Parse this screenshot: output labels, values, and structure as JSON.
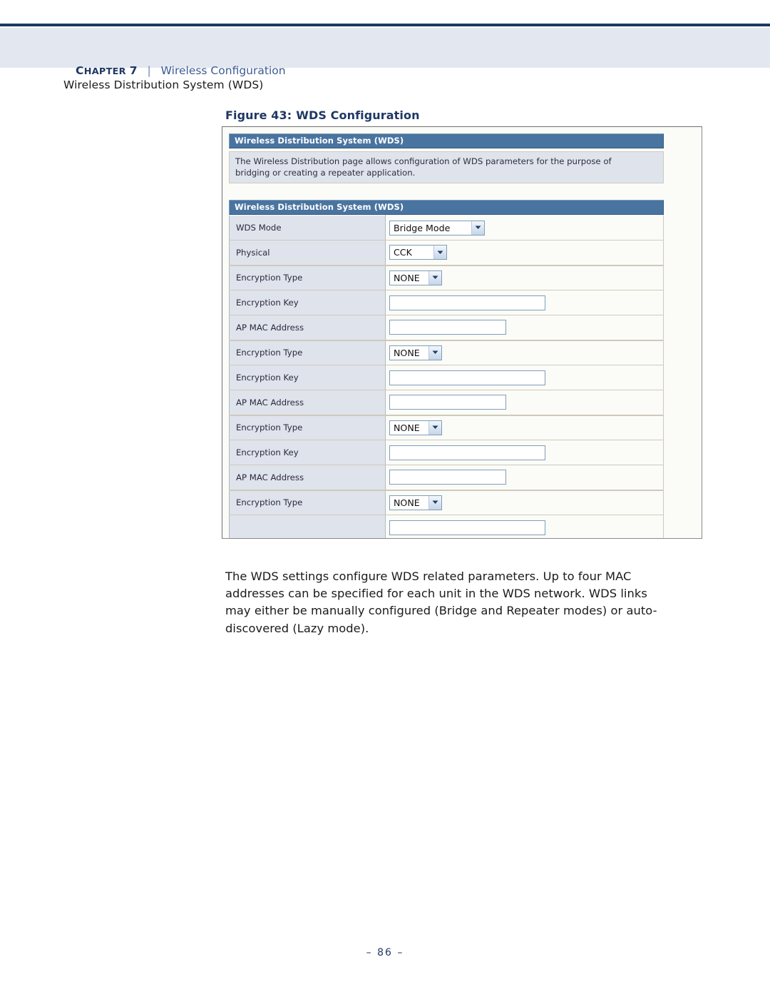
{
  "header": {
    "chapter_label_first": "C",
    "chapter_label_rest": "HAPTER",
    "chapter_number": "7",
    "separator": "|",
    "section_title": "Wireless Configuration",
    "subsection_title": "Wireless Distribution System (WDS)"
  },
  "figure": {
    "label": "Figure 43:",
    "title": "WDS Configuration"
  },
  "screenshot": {
    "panel_title": "Wireless Distribution System (WDS)",
    "description_lines": [
      "The Wireless Distribution page allows configuration of WDS parameters for the purpose of",
      "bridging or creating a repeater application."
    ],
    "section_title": "Wireless Distribution System (WDS)",
    "rows": [
      {
        "label": "WDS Mode",
        "control": "select",
        "value": "Bridge Mode",
        "width": "wide",
        "group_end": false
      },
      {
        "label": "Physical",
        "control": "select",
        "value": "CCK",
        "width": "mid",
        "group_end": true
      },
      {
        "label": "Encryption Type",
        "control": "select",
        "value": "NONE",
        "width": "none",
        "group_end": false
      },
      {
        "label": "Encryption Key",
        "control": "input",
        "value": "",
        "width": "wide",
        "group_end": false
      },
      {
        "label": "AP MAC Address",
        "control": "input",
        "value": "",
        "width": "mid",
        "group_end": true
      },
      {
        "label": "Encryption Type",
        "control": "select",
        "value": "NONE",
        "width": "none",
        "group_end": false
      },
      {
        "label": "Encryption Key",
        "control": "input",
        "value": "",
        "width": "wide",
        "group_end": false
      },
      {
        "label": "AP MAC Address",
        "control": "input",
        "value": "",
        "width": "mid",
        "group_end": true
      },
      {
        "label": "Encryption Type",
        "control": "select",
        "value": "NONE",
        "width": "none",
        "group_end": false
      },
      {
        "label": "Encryption Key",
        "control": "input",
        "value": "",
        "width": "wide",
        "group_end": false
      },
      {
        "label": "AP MAC Address",
        "control": "input",
        "value": "",
        "width": "mid",
        "group_end": true
      },
      {
        "label": "Encryption Type",
        "control": "select",
        "value": "NONE",
        "width": "none",
        "group_end": false
      },
      {
        "label": "",
        "control": "input",
        "value": "",
        "width": "wide",
        "group_end": false
      }
    ],
    "colors": {
      "title_bar": "#4a74a0",
      "label_cell": "#dfe3ec",
      "value_cell": "#fbfcf7",
      "row_divider": "#cfc9bd",
      "input_border": "#7f9db9"
    }
  },
  "body": {
    "paragraph_lines": [
      "The WDS settings configure WDS related parameters. Up to four MAC",
      "addresses can be specified for each unit in the WDS network. WDS links",
      "may either be manually configured (Bridge and Repeater modes) or auto-",
      "discovered (Lazy mode)."
    ]
  },
  "footer": {
    "page_number": "–  86  –"
  }
}
